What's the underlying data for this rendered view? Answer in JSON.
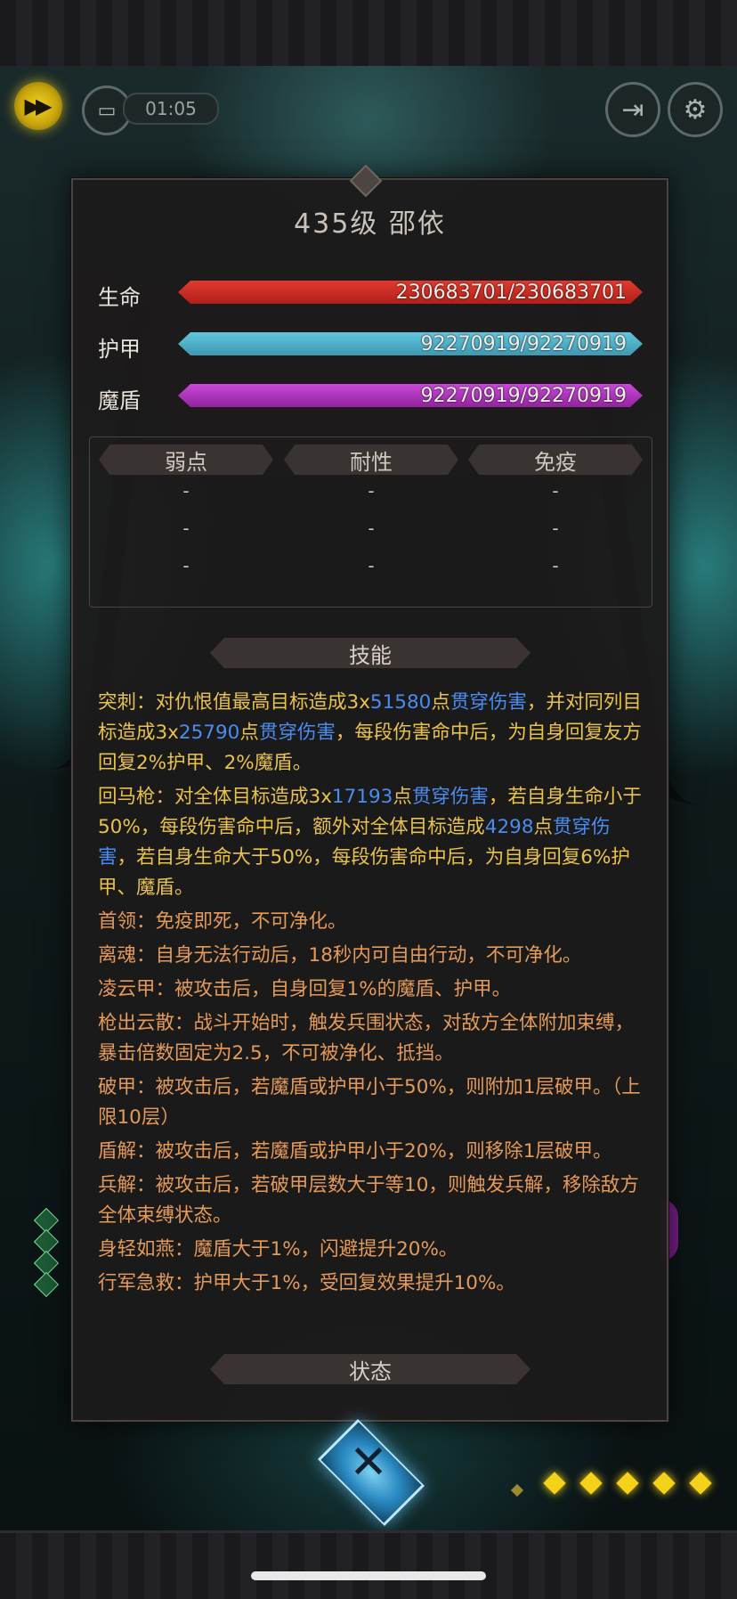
{
  "hud": {
    "timer": "01:05",
    "fast_forward_icon": "fast-forward-icon",
    "auto_icon": "auto-battle-icon",
    "exit_icon": "exit-icon",
    "settings_icon": "gear-icon"
  },
  "panel": {
    "title": "435级  邵依",
    "stats": [
      {
        "label": "生命",
        "value": "230683701/230683701",
        "color": "#d42d24"
      },
      {
        "label": "护甲",
        "value": "92270919/92270919",
        "color": "#4fb2cc"
      },
      {
        "label": "魔盾",
        "value": "92270919/92270919",
        "color": "#b038c0"
      }
    ],
    "resist_headers": [
      "弱点",
      "耐性",
      "免疫"
    ],
    "resist_rows": [
      [
        "-",
        "-",
        "-"
      ],
      [
        "-",
        "-",
        "-"
      ],
      [
        "-",
        "-",
        "-"
      ]
    ],
    "skills_title": "技能",
    "status_title": "状态",
    "skills": [
      {
        "name": "突刺：",
        "parts": [
          {
            "t": "对仇恨值最高目标造成3x",
            "c": "y"
          },
          {
            "t": "51580",
            "c": "b"
          },
          {
            "t": "点",
            "c": "y"
          },
          {
            "t": "贯穿伤害",
            "c": "b"
          },
          {
            "t": "，并对同列目标造成3x",
            "c": "y"
          },
          {
            "t": "25790",
            "c": "b"
          },
          {
            "t": "点",
            "c": "y"
          },
          {
            "t": "贯穿伤害",
            "c": "b"
          },
          {
            "t": "，每段伤害命中后，为自身回复友方回复2%护甲、2%魔盾。",
            "c": "y"
          }
        ]
      },
      {
        "name": "回马枪：",
        "parts": [
          {
            "t": "对全体目标造成3x",
            "c": "y"
          },
          {
            "t": "17193",
            "c": "b"
          },
          {
            "t": "点",
            "c": "y"
          },
          {
            "t": "贯穿伤害",
            "c": "b"
          },
          {
            "t": "，若自身生命小于50%，每段伤害命中后，额外对全体目标造成",
            "c": "y"
          },
          {
            "t": "4298",
            "c": "b"
          },
          {
            "t": "点",
            "c": "y"
          },
          {
            "t": "贯穿伤害",
            "c": "b"
          },
          {
            "t": "，若自身生命大于50%，每段伤害命中后，为自身回复6%护甲、魔盾。",
            "c": "y"
          }
        ]
      },
      {
        "name": "首领：",
        "parts": [
          {
            "t": "免疫即死，不可净化。",
            "c": "o"
          }
        ]
      },
      {
        "name": "离魂：",
        "parts": [
          {
            "t": "自身无法行动后，18秒内可自由行动，不可净化。",
            "c": "o"
          }
        ]
      },
      {
        "name": "凌云甲：",
        "parts": [
          {
            "t": "被攻击后，自身回复1%的魔盾、护甲。",
            "c": "o"
          }
        ]
      },
      {
        "name": "枪出云散：",
        "parts": [
          {
            "t": "战斗开始时，触发兵围状态，对敌方全体附加束缚，暴击倍数固定为2.5，不可被净化、抵挡。",
            "c": "o"
          }
        ]
      },
      {
        "name": "破甲：",
        "parts": [
          {
            "t": "被攻击后，若魔盾或护甲小于50%，则附加1层破甲。（上限10层）",
            "c": "o"
          }
        ]
      },
      {
        "name": "盾解：",
        "parts": [
          {
            "t": "被攻击后，若魔盾或护甲小于20%，则移除1层破甲。",
            "c": "o"
          }
        ]
      },
      {
        "name": "兵解：",
        "parts": [
          {
            "t": "被攻击后，若破甲层数大于等10，则触发兵解，移除敌方全体束缚状态。",
            "c": "o"
          }
        ]
      },
      {
        "name": "身轻如燕：",
        "parts": [
          {
            "t": "魔盾大于1%，闪避提升20%。",
            "c": "o"
          }
        ]
      },
      {
        "name": "行军急救：",
        "parts": [
          {
            "t": "护甲大于1%，受回复效果提升10%。",
            "c": "o"
          }
        ]
      }
    ]
  },
  "bottom": {
    "close_icon": "crossed-swords-icon"
  },
  "colors": {
    "skill_yellow": "#e9c24c",
    "skill_blue": "#4a8cf0",
    "skill_orange": "#e49a58",
    "accent_gold": "#f4d21a"
  }
}
